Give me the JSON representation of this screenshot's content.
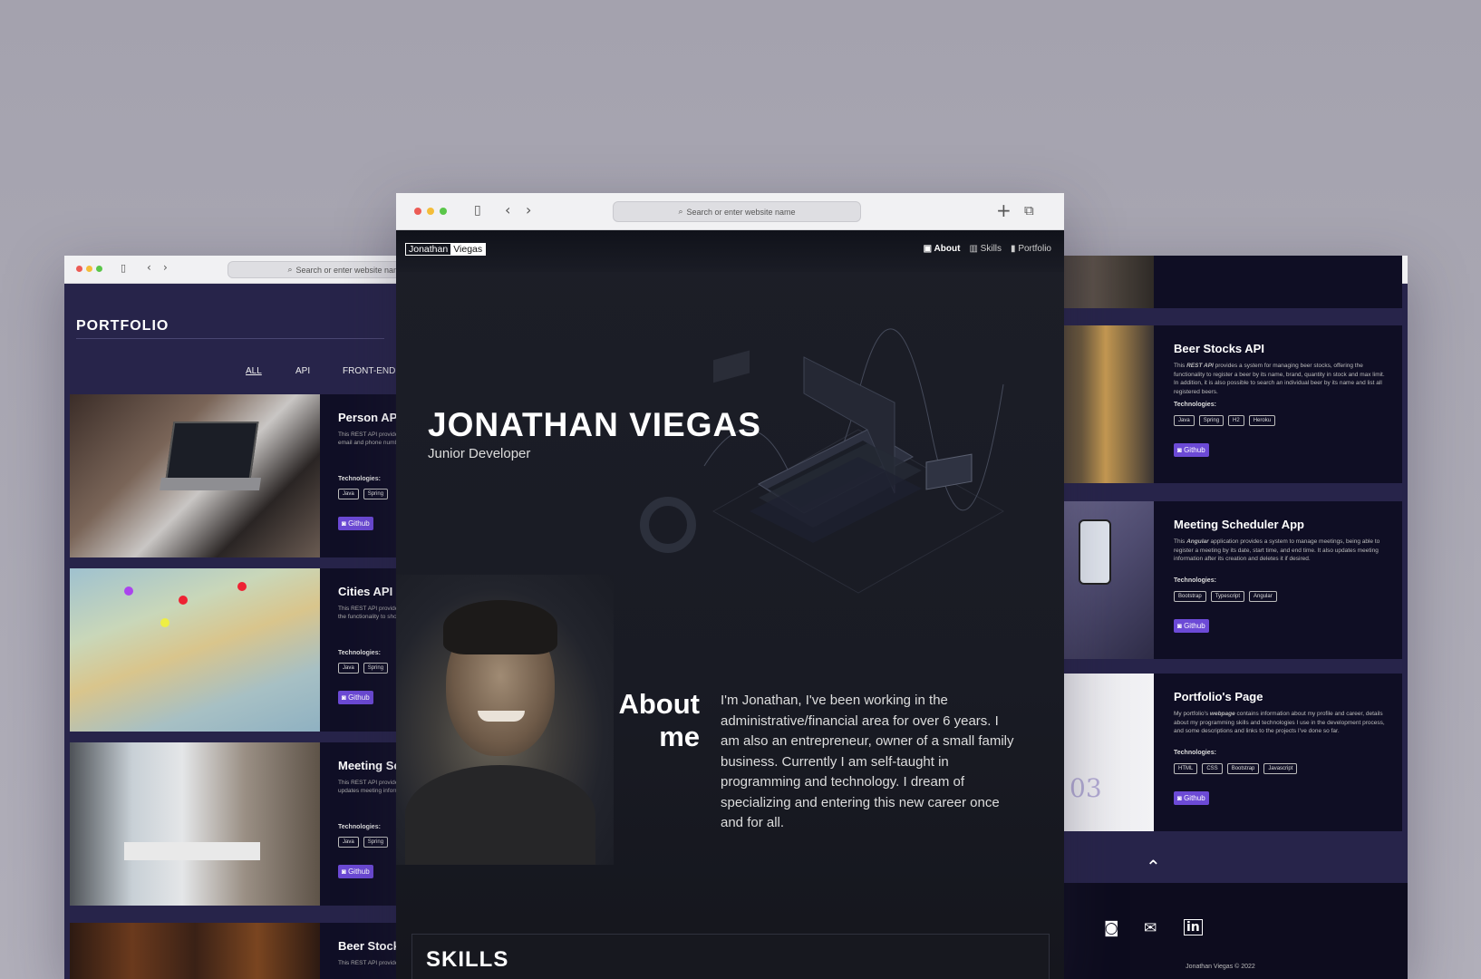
{
  "browser": {
    "address_placeholder": "Search or enter website name"
  },
  "left": {
    "section_title": "PORTFOLIO",
    "filters": [
      "ALL",
      "API",
      "FRONT-END"
    ],
    "cards": [
      {
        "title": "Person API",
        "desc": "This REST API provides a system to register a person by its name, email and phone number, edit, delete, read or list all records again.",
        "tech_label": "Technologies:",
        "tags": [
          "Java",
          "Spring"
        ],
        "github": "Github"
      },
      {
        "title": "Cities API",
        "desc": "This REST API provides information related to cities. It also provides the functionality to show two locations by the distance.",
        "tech_label": "Technologies:",
        "tags": [
          "Java",
          "Spring"
        ],
        "github": "Github"
      },
      {
        "title": "Meeting Scheduler",
        "desc": "This REST API provides a system to register a meeting and its updates meeting information as desired.",
        "tech_label": "Technologies:",
        "tags": [
          "Java",
          "Spring"
        ],
        "github": "Github"
      },
      {
        "title": "Beer Stocks API",
        "desc": "This REST API provides",
        "tech_label": "",
        "tags": [],
        "github": ""
      }
    ]
  },
  "center": {
    "logo_first": "Jonathan",
    "logo_last": "Viegas",
    "nav": {
      "about": "About",
      "skills": "Skills",
      "portfolio": "Portfolio"
    },
    "hero_name": "JONATHAN VIEGAS",
    "hero_role": "Junior Developer",
    "about_heading_1": "About",
    "about_heading_2": "me",
    "about_text": "I'm Jonathan, I've been working in the administrative/financial area for over 6 years. I am also an entrepreneur, owner of a small family business. Currently I am self-taught in programming and technology. I dream of specializing and entering this new career once and for all.",
    "skills_heading": "SKILLS"
  },
  "right": {
    "cards": [
      {
        "title": "Beer Stocks API",
        "desc_lead": "This ",
        "desc_em": "REST API",
        "desc_rest": " provides a system for managing beer stocks, offering the functionality to register a beer by its name, brand, quantity in stock and max limit. In addition, it is also possible to search an individual beer by its name and list all registered beers.",
        "tech_label": "Technologies:",
        "tags": [
          "Java",
          "Spring",
          "H2",
          "Heroku"
        ],
        "github": "Github"
      },
      {
        "title": "Meeting Scheduler App",
        "desc_lead": "This ",
        "desc_em": "Angular",
        "desc_rest": " application provides a system to manage meetings, being able to register a meeting by its date, start time, and end time. It also updates meeting information after its creation and deletes it if desired.",
        "tech_label": "Technologies:",
        "tags": [
          "Bootstrap",
          "Typescript",
          "Angular"
        ],
        "github": "Github"
      },
      {
        "title": "Portfolio's Page",
        "desc_lead": "My portfolio's ",
        "desc_em": "webpage",
        "desc_rest": " contains information about my profile and career, details about my programming skills and technologies I use in the development process, and some descriptions and links to the projects I've done so far.",
        "tech_label": "Technologies:",
        "tags": [
          "HTML",
          "CSS",
          "Bootstrap",
          "Javascript"
        ],
        "github": "Github"
      }
    ],
    "footer_copyright": "Jonathan Viegas © 2022"
  }
}
